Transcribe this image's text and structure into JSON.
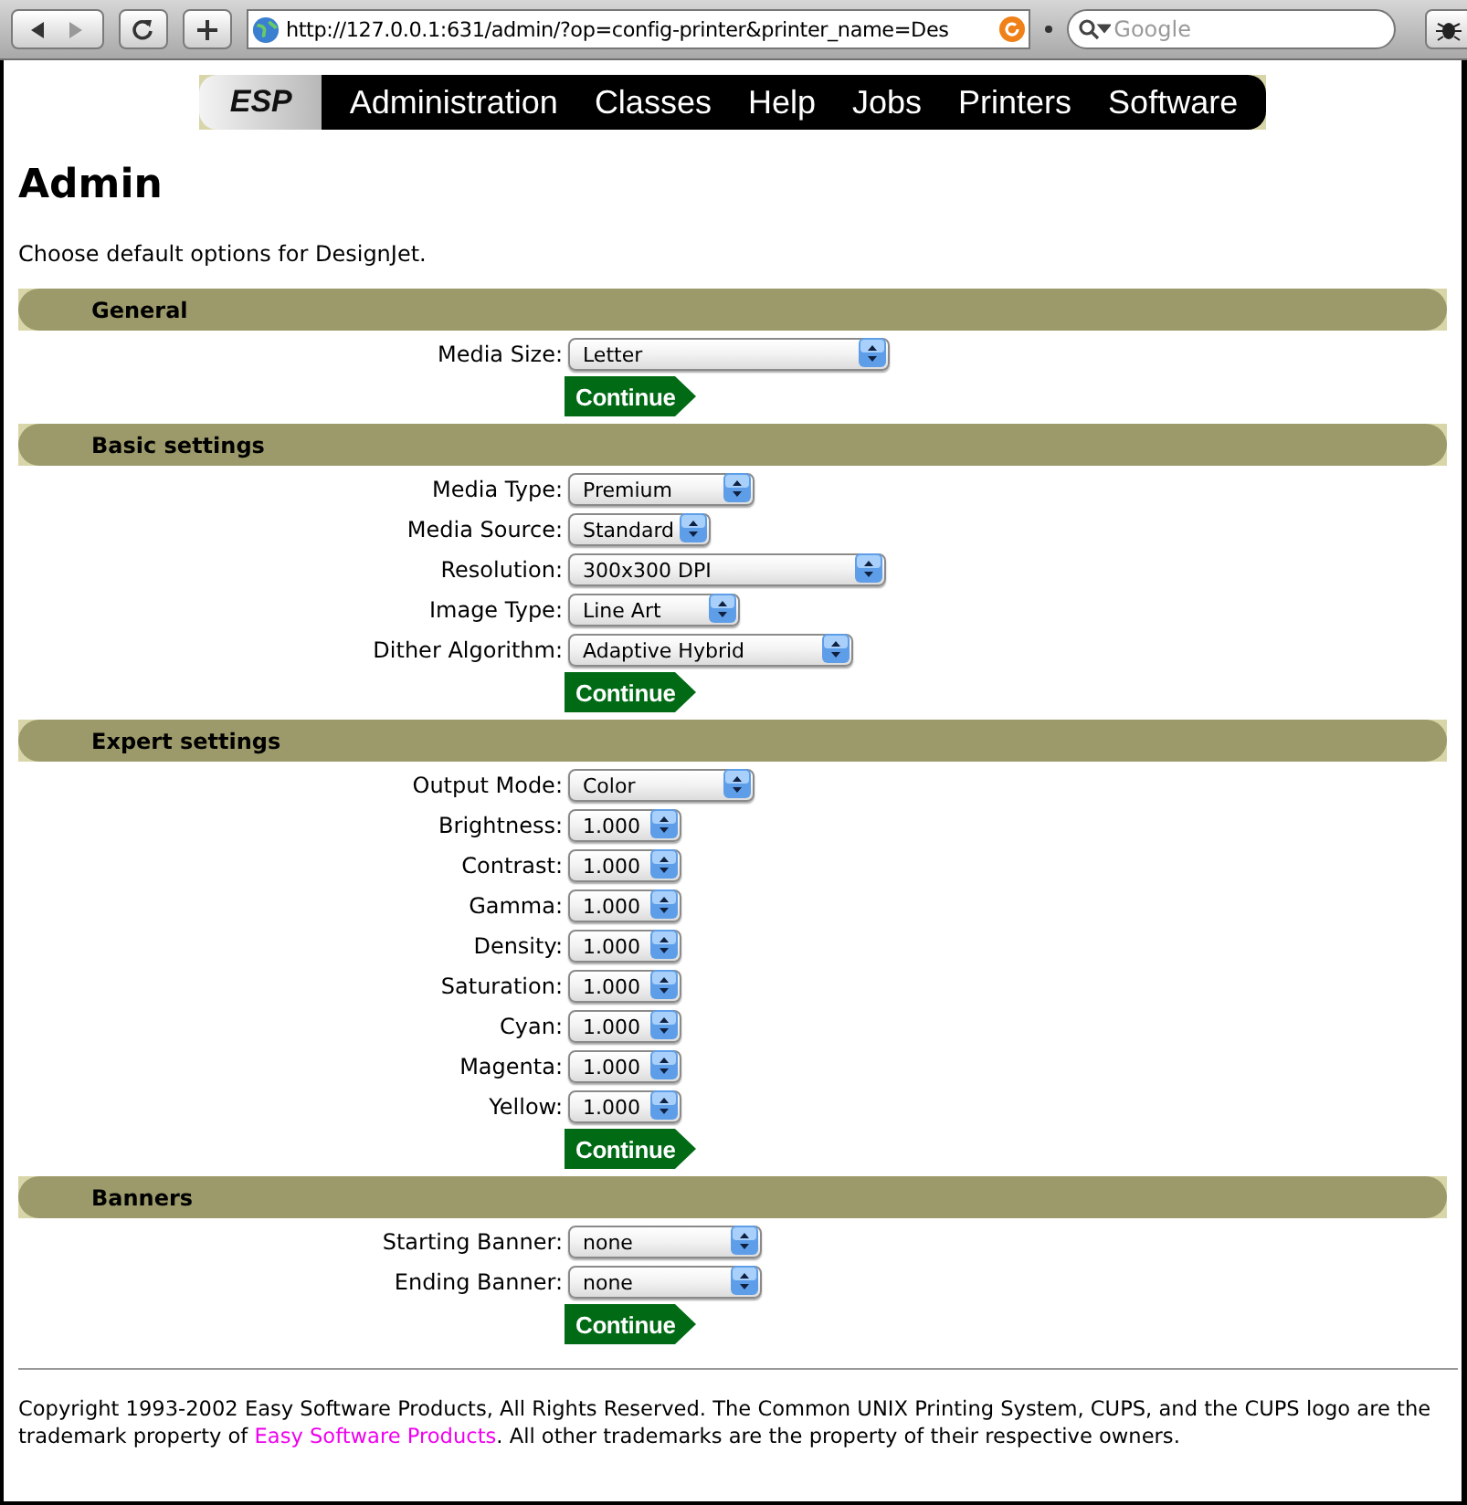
{
  "browser": {
    "url": "http://127.0.0.1:631/admin/?op=config-printer&printer_name=Des",
    "search_placeholder": "Google"
  },
  "nav": {
    "logo": "ESP",
    "items": [
      "Administration",
      "Classes",
      "Help",
      "Jobs",
      "Printers",
      "Software"
    ]
  },
  "title": "Admin",
  "description": "Choose default options for DesignJet.",
  "sections": [
    {
      "title": "General",
      "fields": [
        {
          "label": "Media Size:",
          "value": "Letter"
        }
      ],
      "button": "Continue"
    },
    {
      "title": "Basic settings",
      "fields": [
        {
          "label": "Media Type:",
          "value": "Premium"
        },
        {
          "label": "Media Source:",
          "value": "Standard"
        },
        {
          "label": "Resolution:",
          "value": "300x300 DPI"
        },
        {
          "label": "Image Type:",
          "value": "Line Art"
        },
        {
          "label": "Dither Algorithm:",
          "value": "Adaptive Hybrid"
        }
      ],
      "button": "Continue"
    },
    {
      "title": "Expert settings",
      "fields": [
        {
          "label": "Output Mode:",
          "value": "Color"
        },
        {
          "label": "Brightness:",
          "value": "1.000"
        },
        {
          "label": "Contrast:",
          "value": "1.000"
        },
        {
          "label": "Gamma:",
          "value": "1.000"
        },
        {
          "label": "Density:",
          "value": "1.000"
        },
        {
          "label": "Saturation:",
          "value": "1.000"
        },
        {
          "label": "Cyan:",
          "value": "1.000"
        },
        {
          "label": "Magenta:",
          "value": "1.000"
        },
        {
          "label": "Yellow:",
          "value": "1.000"
        }
      ],
      "button": "Continue"
    },
    {
      "title": "Banners",
      "fields": [
        {
          "label": "Starting Banner:",
          "value": "none"
        },
        {
          "label": "Ending Banner:",
          "value": "none"
        }
      ],
      "button": "Continue"
    }
  ],
  "footer": {
    "text_before": "Copyright 1993-2002 Easy Software Products, All Rights Reserved. The Common UNIX Printing System, CUPS, and the CUPS logo are the trademark property of ",
    "link": "Easy Software Products",
    "text_after": ". All other trademarks are the property of their respective owners."
  }
}
